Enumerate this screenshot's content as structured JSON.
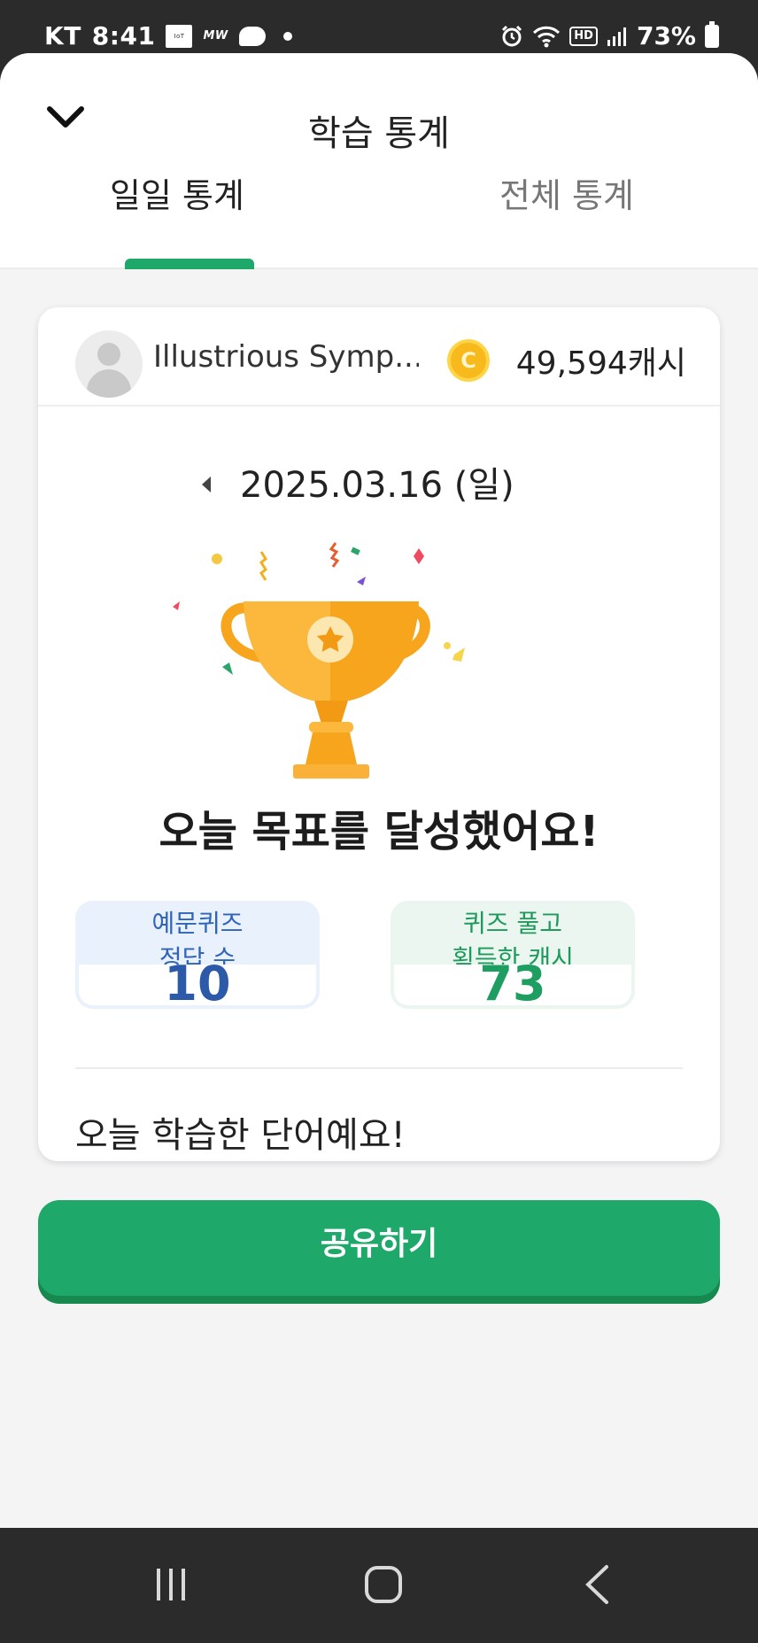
{
  "status_bar": {
    "carrier": "KT",
    "time": "8:41",
    "mini_app_label": "IoT",
    "mini_text": "MW",
    "hd_label": "HD",
    "battery": "73%"
  },
  "header": {
    "title": "학습 통계",
    "back_icon": "chevron-down-icon",
    "tabs": [
      {
        "label": "일일 통계",
        "active": true
      },
      {
        "label": "전체 통계",
        "active": false
      }
    ]
  },
  "card": {
    "username": "Illustrious Symp...",
    "coin_symbol": "C",
    "cash": "49,594캐시",
    "date": "2025.03.16 (일)",
    "goal_message": "오늘 목표를 달성했어요!",
    "stats": [
      {
        "title_line1": "예문퀴즈",
        "title_line2": "정답 수",
        "value": "10"
      },
      {
        "title_line1": "퀴즈 풀고",
        "title_line2": "획득한 캐시",
        "value": "73"
      }
    ],
    "words_title": "오늘 학습한 단어예요!"
  },
  "share_button": "공유하기",
  "colors": {
    "accent": "#1ea86a",
    "blue": "#2c5aa8",
    "coin": "#f7b91c",
    "trophy": "#f7a51c"
  },
  "icons": [
    "chevron-down-icon",
    "coin-icon",
    "caret-left-icon",
    "trophy-icon",
    "recents-icon",
    "home-icon",
    "back-icon"
  ]
}
